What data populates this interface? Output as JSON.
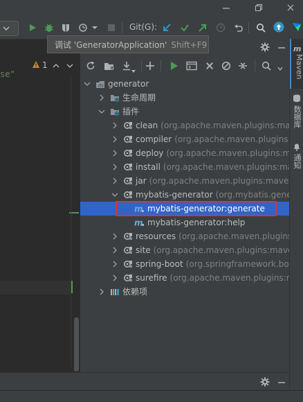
{
  "titlebar": {
    "min_icon": "minimize-icon",
    "restore_icon": "restore-icon",
    "close_icon": "close-icon"
  },
  "toolbar": {
    "git_label": "Git(G):",
    "accent_blue": "#3592c4",
    "accent_green": "#499c54"
  },
  "tooltip": {
    "text": "调试 'GeneratorApplication'",
    "shortcut": "Shift+F9"
  },
  "editor": {
    "string_fragment": "se\"",
    "warning_count": "1"
  },
  "maven": {
    "side_tab": "Maven",
    "side_tabs": [
      "数据库",
      "通知"
    ],
    "tree": [
      {
        "label": "generator",
        "gid": "",
        "level": 0,
        "arrow": "down",
        "icon": "maven-module-icon"
      },
      {
        "label": "生命周期",
        "gid": "",
        "level": 1,
        "arrow": "right",
        "icon": "lifecycle-folder-icon"
      },
      {
        "label": "插件",
        "gid": "",
        "level": 1,
        "arrow": "down",
        "icon": "plugins-folder-icon"
      },
      {
        "label": "clean",
        "gid": "(org.apache.maven.plugins:maven-",
        "level": 2,
        "arrow": "right",
        "icon": "plugin-icon"
      },
      {
        "label": "compiler",
        "gid": "(org.apache.maven.plugins:ma",
        "level": 2,
        "arrow": "right",
        "icon": "plugin-icon"
      },
      {
        "label": "deploy",
        "gid": "(org.apache.maven.plugins:mave",
        "level": 2,
        "arrow": "right",
        "icon": "plugin-icon"
      },
      {
        "label": "install",
        "gid": "(org.apache.maven.plugins:mave",
        "level": 2,
        "arrow": "right",
        "icon": "plugin-icon"
      },
      {
        "label": "jar",
        "gid": "(org.apache.maven.plugins:maven-ja",
        "level": 2,
        "arrow": "right",
        "icon": "plugin-icon"
      },
      {
        "label": "mybatis-generator",
        "gid": "(org.mybatis.genera",
        "level": 2,
        "arrow": "down",
        "icon": "plugin-icon"
      },
      {
        "label": "mybatis-generator:generate",
        "gid": "",
        "level": 3,
        "arrow": "",
        "icon": "goal-icon",
        "selected": true
      },
      {
        "label": "mybatis-generator:help",
        "gid": "",
        "level": 3,
        "arrow": "",
        "icon": "goal-icon"
      },
      {
        "label": "resources",
        "gid": "(org.apache.maven.plugins:m",
        "level": 2,
        "arrow": "right",
        "icon": "plugin-icon"
      },
      {
        "label": "site",
        "gid": "(org.apache.maven.plugins:maven-",
        "level": 2,
        "arrow": "right",
        "icon": "plugin-icon"
      },
      {
        "label": "spring-boot",
        "gid": "(org.springframework.boo",
        "level": 2,
        "arrow": "right",
        "icon": "plugin-icon"
      },
      {
        "label": "surefire",
        "gid": "(org.apache.maven.plugins:mav",
        "level": 2,
        "arrow": "right",
        "icon": "plugin-icon"
      },
      {
        "label": "依赖项",
        "gid": "",
        "level": 1,
        "arrow": "right",
        "icon": "dependencies-icon"
      }
    ]
  }
}
